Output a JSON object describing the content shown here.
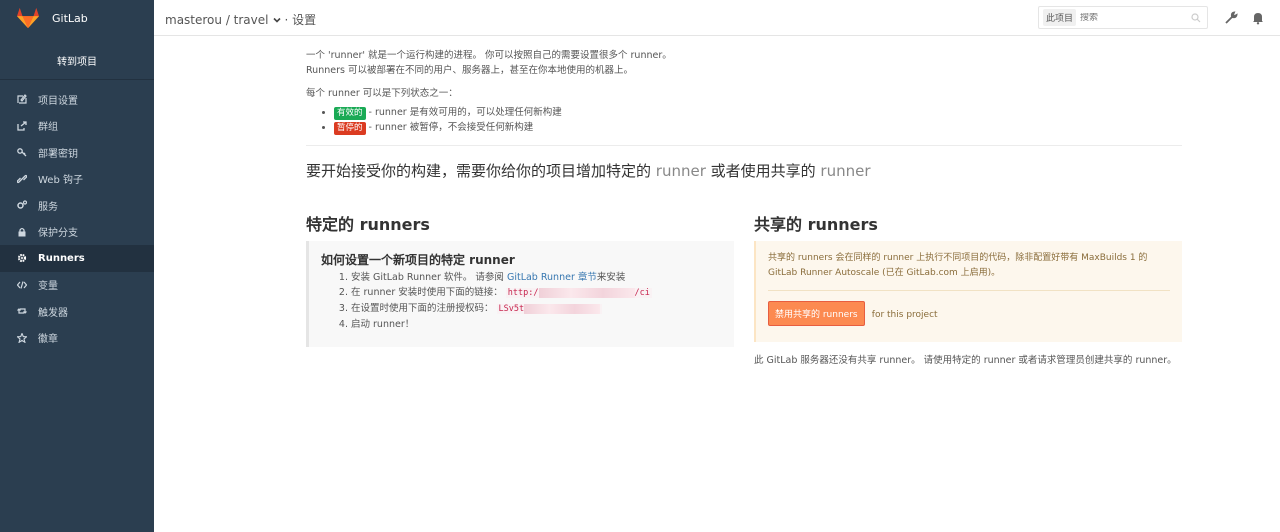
{
  "brand": {
    "name": "GitLab",
    "logo_color": "#e24329"
  },
  "sidebar": {
    "goto_label": "转到项目",
    "items": [
      {
        "label": "项目设置",
        "icon": "edit-icon"
      },
      {
        "label": "群组",
        "icon": "share-icon"
      },
      {
        "label": "部署密钥",
        "icon": "key-icon"
      },
      {
        "label": "Web 钩子",
        "icon": "link-icon"
      },
      {
        "label": "服务",
        "icon": "cogs-icon"
      },
      {
        "label": "保护分支",
        "icon": "lock-icon"
      },
      {
        "label": "Runners",
        "icon": "gear-icon",
        "active": true
      },
      {
        "label": "变量",
        "icon": "code-icon"
      },
      {
        "label": "触发器",
        "icon": "retweet-icon"
      },
      {
        "label": "徽章",
        "icon": "star-icon"
      }
    ]
  },
  "header": {
    "breadcrumb_project": "masterou / travel",
    "breadcrumb_page": "· 设置",
    "search_scope": "此项目",
    "search_placeholder": "搜索"
  },
  "content": {
    "intro_line1": "一个 'runner' 就是一个运行构建的进程。 你可以按照自己的需要设置很多个 runner。",
    "intro_line2": "Runners 可以被部署在不同的用户、服务器上，甚至在你本地使用的机器上。",
    "states_intro": "每个 runner 可以是下列状态之一：",
    "state_active_badge": "有效的",
    "state_active_text": " - runner 是有效可用的，可以处理任何新构建",
    "state_paused_badge": "暂停的",
    "state_paused_text": " - runner 被暂停，不会接受任何新构建",
    "lead_a": "要开始接受你的构建，需要你给你的项目增加特定的 ",
    "lead_runner1": "runner",
    "lead_b": " 或者使用共享的 ",
    "lead_runner2": "runner"
  },
  "specific": {
    "title": "特定的 runners",
    "howto_title": "如何设置一个新项目的特定 runner",
    "step1_text": "安装 GitLab Runner 软件。 请参阅 ",
    "step1_link": "GitLab Runner 章节",
    "step1_tail": "来安装",
    "step2_text": "在 runner 安装时使用下面的链接：",
    "step2_code_a": "http:/",
    "step2_code_b": "/ci",
    "step3_text": "在设置时使用下面的注册授权码：",
    "step3_code": "LSv5t",
    "step4_text": "启动 runner！"
  },
  "shared": {
    "title": "共享的 runners",
    "notice": "共享的 runners 会在同样的 runner 上执行不同项目的代码，除非配置好带有 MaxBuilds 1 的 GitLab Runner Autoscale (已在 GitLab.com 上启用)。",
    "disable_button": "禁用共享的 runners",
    "for_project": "for this project",
    "no_shared": "此 GitLab 服务器还没有共享 runner。 请使用特定的 runner 或者请求管理员创建共享的 runner。"
  },
  "colors": {
    "sidebar_bg": "#2b3e50",
    "active_badge": "#1aaa55",
    "paused_badge": "#db3b21",
    "link": "#3777b0",
    "button": "#fc8a51"
  }
}
